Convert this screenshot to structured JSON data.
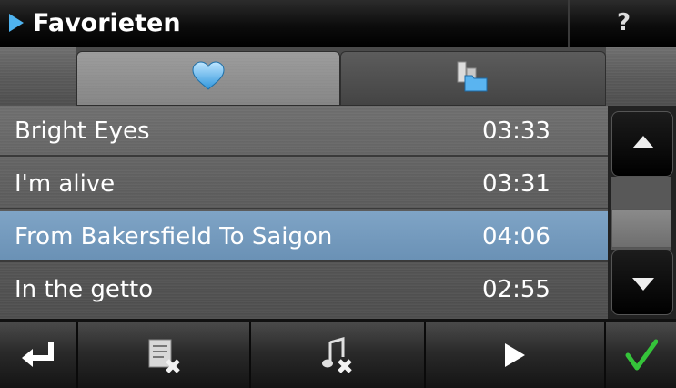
{
  "header": {
    "title": "Favorieten",
    "help_label": "?"
  },
  "tabs": [
    {
      "icon": "heart-icon",
      "selected": true
    },
    {
      "icon": "folder-icon",
      "selected": false
    }
  ],
  "list": {
    "items": [
      {
        "name": "Bright Eyes",
        "duration": "03:33",
        "selected": false
      },
      {
        "name": "I'm alive",
        "duration": "03:31",
        "selected": false
      },
      {
        "name": "From Bakersfield To Saigon",
        "duration": "04:06",
        "selected": true
      },
      {
        "name": "In the getto",
        "duration": "02:55",
        "selected": false
      }
    ]
  },
  "toolbar": {
    "buttons": [
      "back-arrow-icon",
      "delete-list-icon",
      "delete-song-icon",
      "play-icon",
      "checkmark-icon"
    ]
  },
  "colors": {
    "accent_blue": "#4fb3ef",
    "selected_row": "#7fa4c6",
    "confirm_green": "#35c43a"
  }
}
